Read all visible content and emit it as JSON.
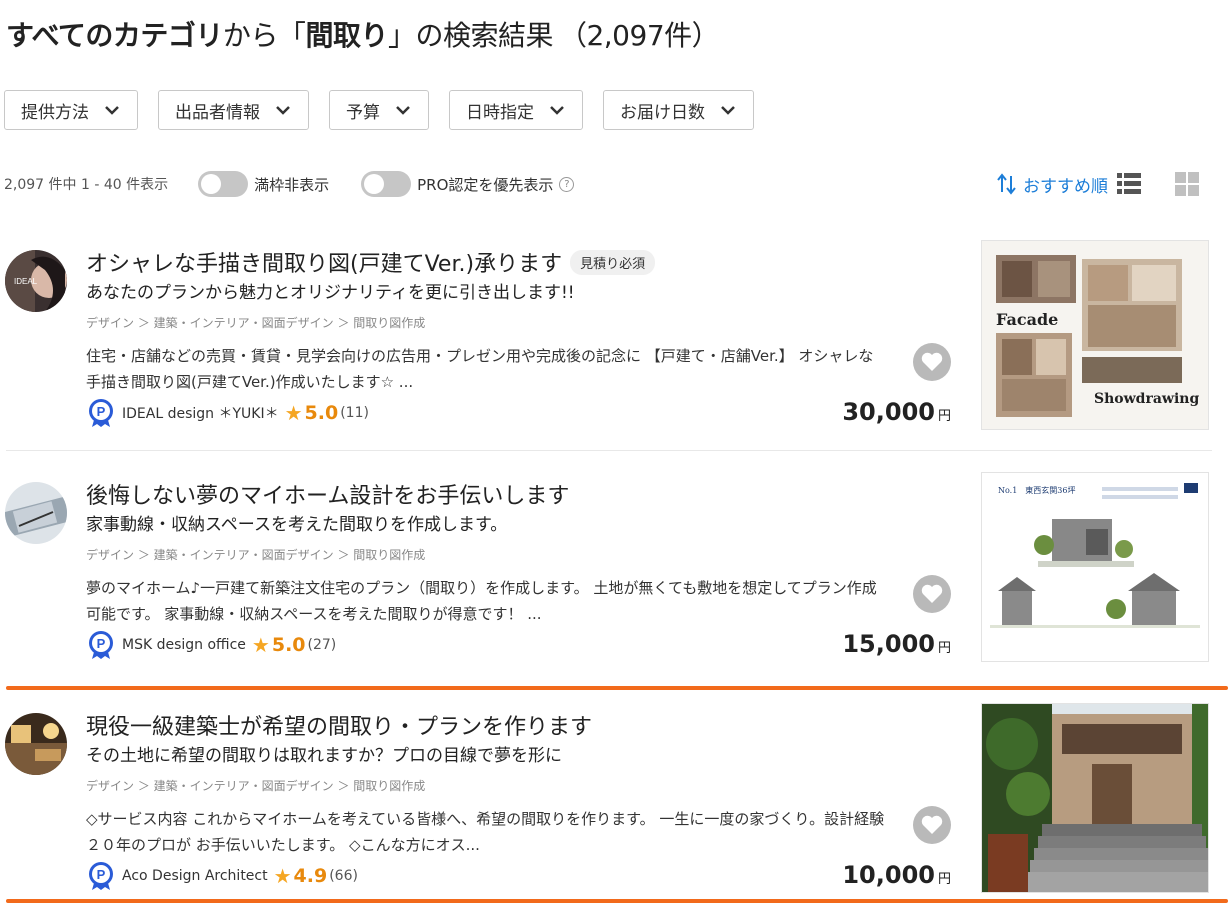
{
  "header": {
    "category": "すべてのカテゴリ",
    "from": "から「",
    "keyword": "間取り",
    "suffix": "」の検索結果",
    "count": "（2,097件）"
  },
  "filters": [
    "提供方法",
    "出品者情報",
    "予算",
    "日時指定",
    "お届け日数"
  ],
  "toolbar": {
    "count_text": "2,097 件中 1 - 40 件表示",
    "toggle1": "満枠非表示",
    "toggle2": "PRO認定を優先表示",
    "help": "?",
    "sort": "おすすめ順"
  },
  "items": [
    {
      "title": "オシャレな手描き間取り図(戸建てVer.)承ります",
      "badge": "見積り必須",
      "subtitle": "あなたのプランから魅力とオリジナリティを更に引き出します!!",
      "crumbs": "デザイン ＞ 建築・インテリア・図面デザイン ＞ 間取り図作成",
      "desc": "住宅・店舗などの売買・賃貸・見学会向けの広告用・プレゼン用や完成後の記念に 【戸建て・店舗Ver.】 オシャレな手描き間取り図(戸建てVer.)作成いたします☆ ...",
      "seller": "IDEAL design ＊YUKI＊",
      "rating": "5.0",
      "reviews": "(11)",
      "price": "30,000",
      "yen": "円",
      "avatar_text": "IDEAL",
      "thumb_text1": "Facade",
      "thumb_text2": "Showdrawing"
    },
    {
      "title": "後悔しない夢のマイホーム設計をお手伝いします",
      "badge": "",
      "subtitle": "家事動線・収納スペースを考えた間取りを作成します。",
      "crumbs": "デザイン ＞ 建築・インテリア・図面デザイン ＞ 間取り図作成",
      "desc": "夢のマイホーム♪一戸建て新築注文住宅のプラン（間取り）を作成します。 土地が無くても敷地を想定してプラン作成可能です。 家事動線・収納スペースを考えた間取りが得意です！ ...",
      "seller": "MSK design office",
      "rating": "5.0",
      "reviews": "(27)",
      "price": "15,000",
      "yen": "円",
      "thumb_text1": "No.1　東西玄関36坪"
    },
    {
      "title": "現役一級建築士が希望の間取り・プランを作ります",
      "badge": "",
      "subtitle": "その土地に希望の間取りは取れますか？プロの目線で夢を形に",
      "crumbs": "デザイン ＞ 建築・インテリア・図面デザイン ＞ 間取り図作成",
      "desc": "◇サービス内容 これからマイホームを考えている皆様へ、希望の間取りを作ります。 一生に一度の家づくり。設計経験２０年のプロが お手伝いいたします。 ◇こんな方にオス...",
      "seller": "Aco Design Architect",
      "rating": "4.9",
      "reviews": "(66)",
      "price": "10,000",
      "yen": "円"
    }
  ],
  "colors": {
    "accent": "#1d7ed8",
    "highlight": "#f26a1b",
    "star": "#f5a623",
    "pro": "#2a5bd7"
  }
}
